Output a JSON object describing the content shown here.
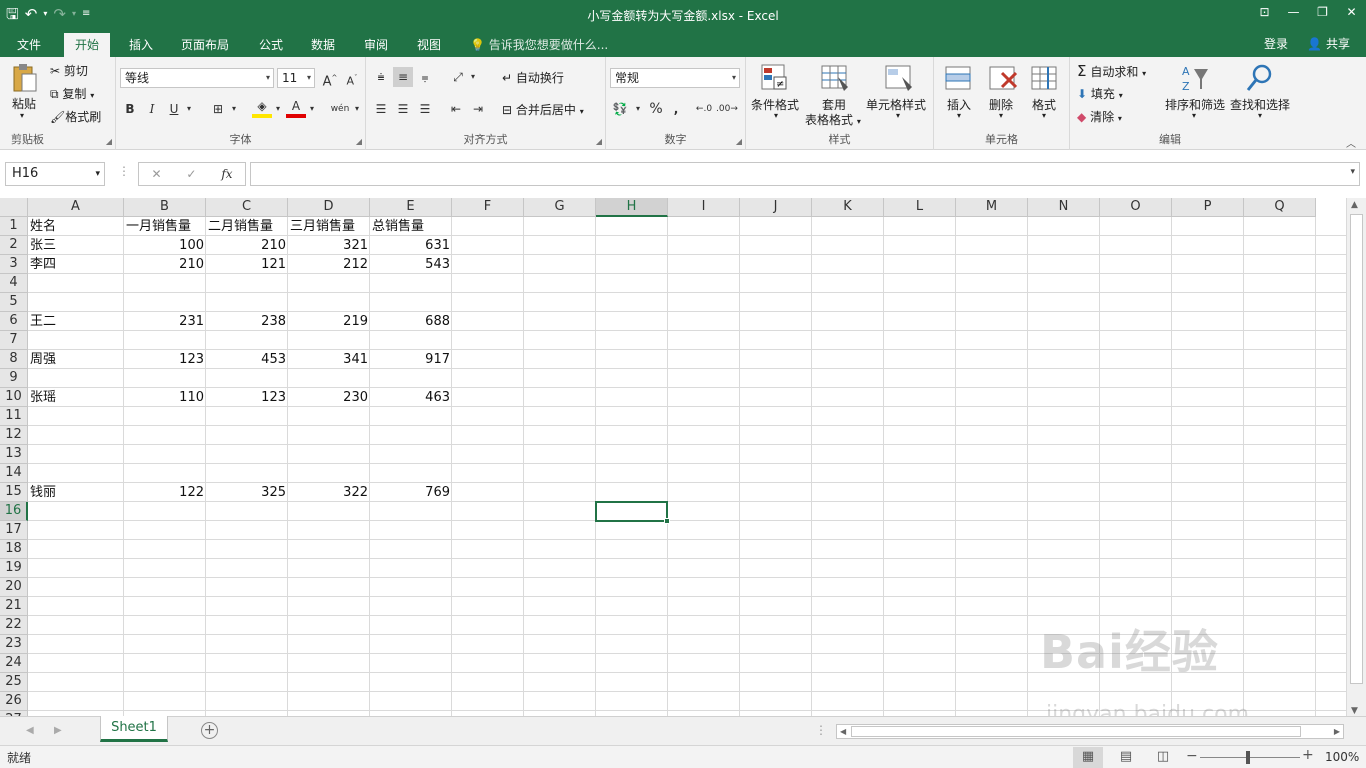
{
  "app": {
    "title": "小写金额转为大写金额.xlsx - Excel",
    "qat": {
      "save_icon": "save-icon",
      "undo_icon": "undo-icon",
      "redo_icon": "redo-icon"
    },
    "window_controls": [
      "ribbon-options-icon",
      "minimize-icon",
      "restore-icon",
      "close-icon"
    ],
    "accent_color": "#217346"
  },
  "tabs": [
    {
      "label": "文件"
    },
    {
      "label": "开始"
    },
    {
      "label": "插入"
    },
    {
      "label": "页面布局"
    },
    {
      "label": "公式"
    },
    {
      "label": "数据"
    },
    {
      "label": "审阅"
    },
    {
      "label": "视图"
    }
  ],
  "active_tab": "开始",
  "tell_me": "告诉我您想要做什么...",
  "account": {
    "login": "登录",
    "share": "共享"
  },
  "ribbon": {
    "clipboard": {
      "label": "剪贴板",
      "paste": "粘贴",
      "cut": "剪切",
      "copy": "复制",
      "format_painter": "格式刷"
    },
    "font": {
      "label": "字体",
      "font_name": "等线",
      "font_size": "11",
      "bold": "B",
      "italic": "I",
      "underline": "U",
      "grow": "A",
      "shrink": "A",
      "font_color": "A",
      "phonetic": "wén"
    },
    "alignment": {
      "label": "对齐方式",
      "wrap_text": "自动换行",
      "merge_center": "合并后居中"
    },
    "number": {
      "label": "数字",
      "format": "常规",
      "percent": "%",
      "comma": ","
    },
    "styles": {
      "label": "样式",
      "conditional": "条件格式",
      "table_line1": "套用",
      "table_line2": "表格格式",
      "cell_styles": "单元格样式"
    },
    "cells": {
      "label": "单元格",
      "insert": "插入",
      "delete": "删除",
      "format": "格式"
    },
    "editing": {
      "label": "编辑",
      "autosum": "自动求和",
      "fill": "填充",
      "clear": "清除",
      "sort_filter": "排序和筛选",
      "find_select": "查找和选择"
    }
  },
  "formula_bar": {
    "name_box": "H16",
    "cancel": "✕",
    "enter": "✓",
    "fx": "fx",
    "formula": ""
  },
  "grid": {
    "columns": [
      "A",
      "B",
      "C",
      "D",
      "E",
      "F",
      "G",
      "H",
      "I",
      "J",
      "K",
      "L",
      "M",
      "N",
      "O",
      "P",
      "Q"
    ],
    "rows": [
      "1",
      "2",
      "3",
      "4",
      "5",
      "6",
      "7",
      "8",
      "9",
      "10",
      "11",
      "12",
      "13",
      "14",
      "15",
      "16",
      "17",
      "18",
      "19",
      "20",
      "21",
      "22",
      "23",
      "24",
      "25",
      "26",
      "27"
    ],
    "selected_column": "H",
    "selected_row": "16",
    "header": [
      "姓名",
      "一月销售量",
      "二月销售量",
      "三月销售量",
      "总销售量"
    ],
    "records": [
      {
        "row": 2,
        "name": "张三",
        "jan": "100",
        "feb": "210",
        "mar": "321",
        "total": "631"
      },
      {
        "row": 3,
        "name": "李四",
        "jan": "210",
        "feb": "121",
        "mar": "212",
        "total": "543"
      },
      {
        "row": 6,
        "name": "王二",
        "jan": "231",
        "feb": "238",
        "mar": "219",
        "total": "688"
      },
      {
        "row": 8,
        "name": "周强",
        "jan": "123",
        "feb": "453",
        "mar": "341",
        "total": "917"
      },
      {
        "row": 10,
        "name": "张瑶",
        "jan": "110",
        "feb": "123",
        "mar": "230",
        "total": "463"
      },
      {
        "row": 15,
        "name": "钱丽",
        "jan": "122",
        "feb": "325",
        "mar": "322",
        "total": "769"
      }
    ]
  },
  "sheets": [
    {
      "label": "Sheet1"
    }
  ],
  "status": {
    "ready": "就绪",
    "zoom": "100%",
    "zoom_level": 1.0,
    "zoom_minus": "−",
    "zoom_plus": "+"
  },
  "watermark": {
    "brand": "Bai经验",
    "url": "jingyan.baidu.com"
  }
}
